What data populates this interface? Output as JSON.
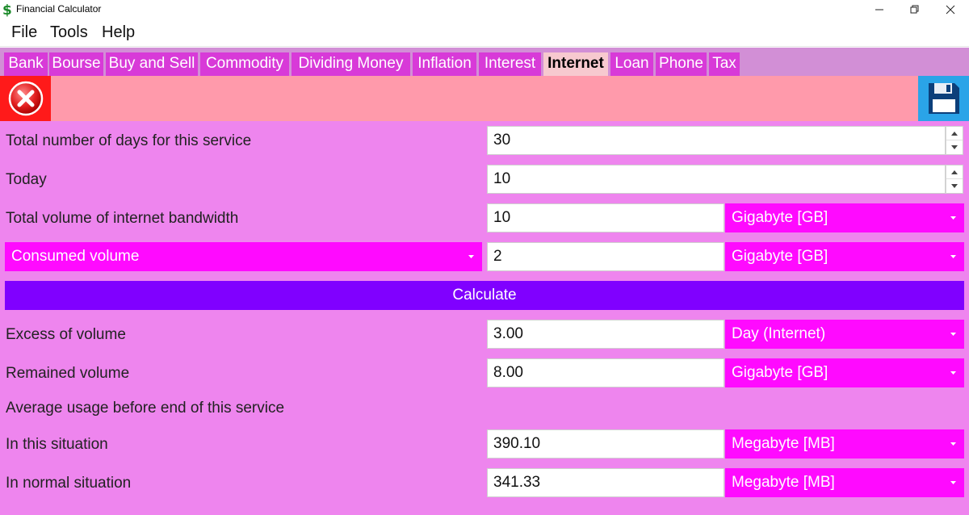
{
  "window": {
    "title": "Financial Calculator",
    "icon": "dollar-icon",
    "controls": [
      "minimize-icon",
      "restore-icon",
      "close-icon"
    ]
  },
  "menu": [
    "File",
    "Tools",
    "Help"
  ],
  "tabs": [
    {
      "label": "Bank",
      "active": false
    },
    {
      "label": "Bourse",
      "active": false
    },
    {
      "label": "Buy and Sell",
      "active": false
    },
    {
      "label": "Commodity",
      "active": false
    },
    {
      "label": "Dividing Money",
      "active": false
    },
    {
      "label": "Inflation",
      "active": false
    },
    {
      "label": "Interest",
      "active": false
    },
    {
      "label": "Internet",
      "active": true
    },
    {
      "label": "Loan",
      "active": false
    },
    {
      "label": "Phone",
      "active": false
    },
    {
      "label": "Tax",
      "active": false
    }
  ],
  "toolbar": {
    "close_icon": "close-circle-icon",
    "save_icon": "floppy-disk-icon"
  },
  "form": {
    "total_days": {
      "label": "Total number of days for this service",
      "value": "30"
    },
    "today": {
      "label": "Today",
      "value": "10"
    },
    "total_volume": {
      "label": "Total volume of internet bandwidth",
      "value": "10",
      "unit": "Gigabyte [GB]"
    },
    "consumed": {
      "mode": "Consumed volume",
      "value": "2",
      "unit": "Gigabyte [GB]"
    },
    "calculate_label": "Calculate",
    "excess": {
      "label": "Excess of volume",
      "value": "3.00",
      "unit": "Day (Internet)"
    },
    "remained": {
      "label": "Remained volume",
      "value": "8.00",
      "unit": "Gigabyte [GB]"
    },
    "average_heading": "Average usage before end of this service",
    "this_situation": {
      "label": "In this situation",
      "value": "390.10",
      "unit": "Megabyte [MB]"
    },
    "normal_situation": {
      "label": "In normal situation",
      "value": "341.33",
      "unit": "Megabyte [MB]"
    }
  },
  "colors": {
    "content_bg": "#ee85ee",
    "combo_bg": "#ff0aff",
    "calculate_bg": "#8000ff",
    "toolbar_bg": "#ff9aab",
    "tab_bg": "#d83ad8",
    "active_tab_bg": "#f7c9cf"
  }
}
